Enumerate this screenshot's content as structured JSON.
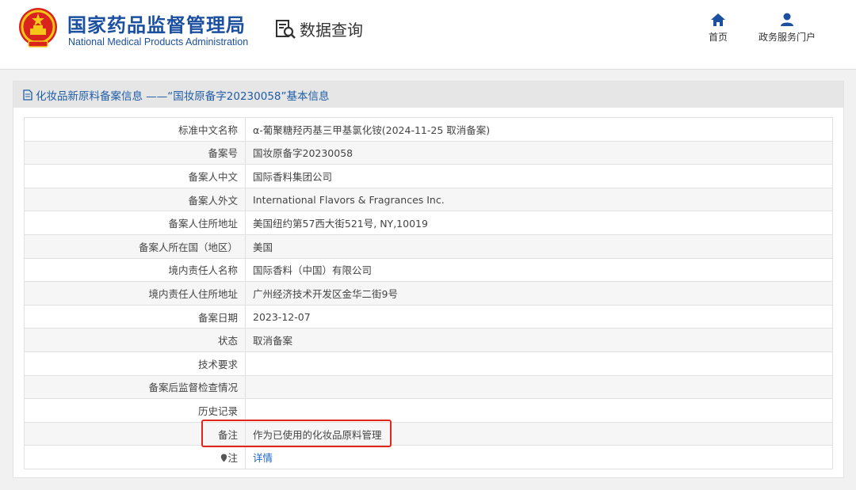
{
  "header": {
    "org_name_cn": "国家药品监督管理局",
    "org_name_en": "National Medical Products Administration",
    "query_label": "数据查询",
    "nav": {
      "home_label": "首页",
      "portal_label": "政务服务门户"
    }
  },
  "panel": {
    "title": "化妆品新原料备案信息 ——“国妆原备字20230058”基本信息"
  },
  "rows": [
    {
      "label": "标准中文名称",
      "value": "α-葡聚糖羟丙基三甲基氯化铵(2024-11-25 取消备案)"
    },
    {
      "label": "备案号",
      "value": "国妆原备字20230058"
    },
    {
      "label": "备案人中文",
      "value": "国际香料集团公司"
    },
    {
      "label": "备案人外文",
      "value": "International Flavors & Fragrances Inc."
    },
    {
      "label": "备案人住所地址",
      "value": "美国纽约第57西大街521号, NY,10019"
    },
    {
      "label": "备案人所在国（地区）",
      "value": "美国"
    },
    {
      "label": "境内责任人名称",
      "value": "国际香料（中国）有限公司"
    },
    {
      "label": "境内责任人住所地址",
      "value": "广州经济技术开发区金华二街9号"
    },
    {
      "label": "备案日期",
      "value": "2023-12-07"
    },
    {
      "label": "状态",
      "value": "取消备案"
    },
    {
      "label": "技术要求",
      "value": ""
    },
    {
      "label": "备案后监督检查情况",
      "value": ""
    },
    {
      "label": "历史记录",
      "value": ""
    },
    {
      "label": "备注",
      "value": "作为已使用的化妆品原料管理"
    },
    {
      "label": "注",
      "value": "详情"
    }
  ],
  "colors": {
    "brand_blue": "#1b4fa0",
    "highlight_red": "#e1251b",
    "link_blue": "#1f64c4"
  }
}
